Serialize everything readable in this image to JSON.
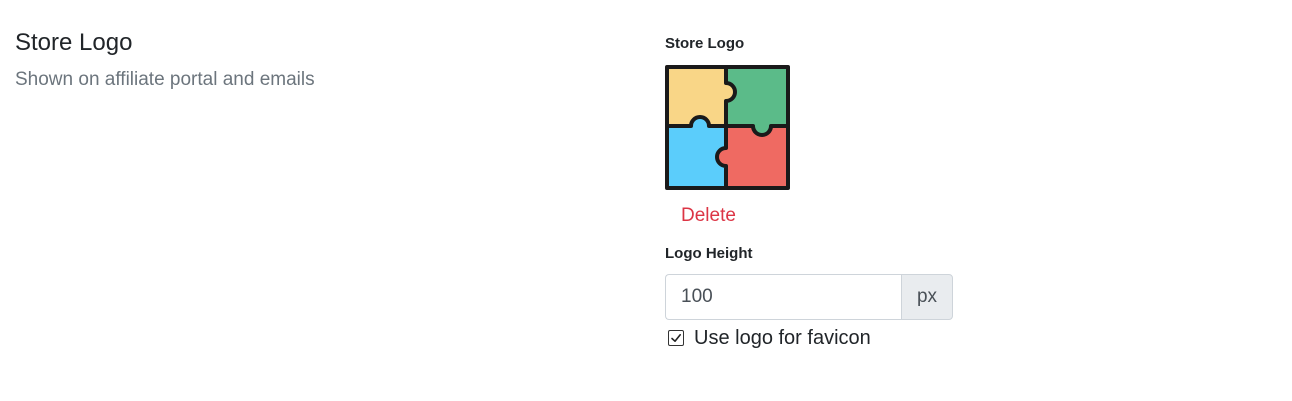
{
  "section": {
    "title": "Store Logo",
    "subtitle": "Shown on affiliate portal and emails"
  },
  "logo_field": {
    "label": "Store Logo",
    "image_icon": "puzzle-pieces-icon",
    "image_colors": [
      "#f9d687",
      "#5bbb89",
      "#5bcdfb",
      "#ef6a62"
    ],
    "delete_label": "Delete"
  },
  "height_field": {
    "label": "Logo Height",
    "value": "100",
    "unit": "px"
  },
  "favicon_option": {
    "label": "Use logo for favicon",
    "checked": true
  },
  "colors": {
    "danger": "#dc3545",
    "muted": "#6c757d"
  }
}
